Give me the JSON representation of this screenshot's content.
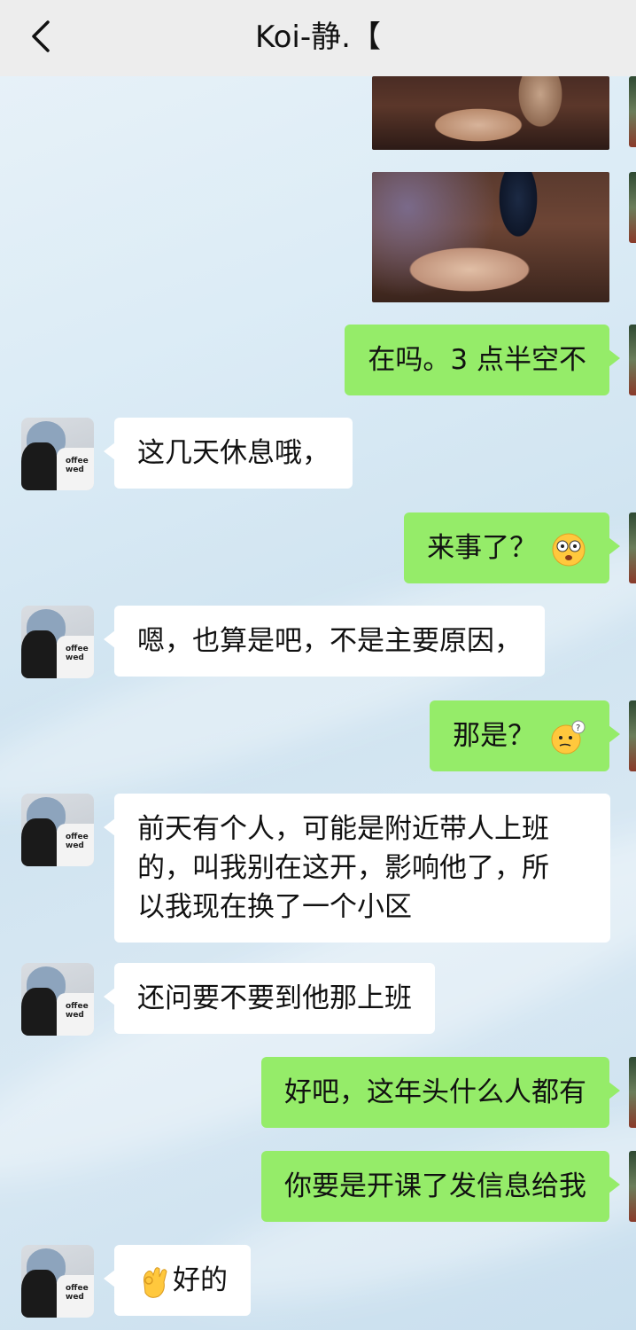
{
  "header": {
    "title": "Koi-静.【",
    "back_icon": "chevron-left-icon"
  },
  "colors": {
    "self_bubble": "#95ec69",
    "other_bubble": "#ffffff",
    "header_bg": "#ededed"
  },
  "messages": [
    {
      "side": "right",
      "type": "image",
      "content_icon": "photo-thumbnail"
    },
    {
      "side": "right",
      "type": "image",
      "content_icon": "photo-thumbnail"
    },
    {
      "side": "right",
      "type": "text",
      "text": "在吗。3 点半空不"
    },
    {
      "side": "left",
      "type": "text",
      "text": "这几天休息哦，"
    },
    {
      "side": "right",
      "type": "text",
      "text": "来事了？",
      "emoji": "shocked-face-emoji"
    },
    {
      "side": "left",
      "type": "text",
      "text": "嗯，也算是吧，不是主要原因，"
    },
    {
      "side": "right",
      "type": "text",
      "text": "那是？",
      "emoji": "confused-question-face-emoji"
    },
    {
      "side": "left",
      "type": "text",
      "lines": [
        "前天有个人，可能是附近带人上班",
        "的，叫我别在这开，影响他了，所",
        "以我现在换了一个小区"
      ]
    },
    {
      "side": "left",
      "type": "text",
      "text": "还问要不要到他那上班"
    },
    {
      "side": "right",
      "type": "text",
      "text": "好吧，这年头什么人都有"
    },
    {
      "side": "right",
      "type": "text",
      "text": "你要是开课了发信息给我"
    },
    {
      "side": "left",
      "type": "text",
      "text": "好的",
      "emoji_before": "ok-hand-emoji"
    }
  ],
  "avatar": {
    "shirt_lines": [
      "offee",
      "wed"
    ]
  }
}
